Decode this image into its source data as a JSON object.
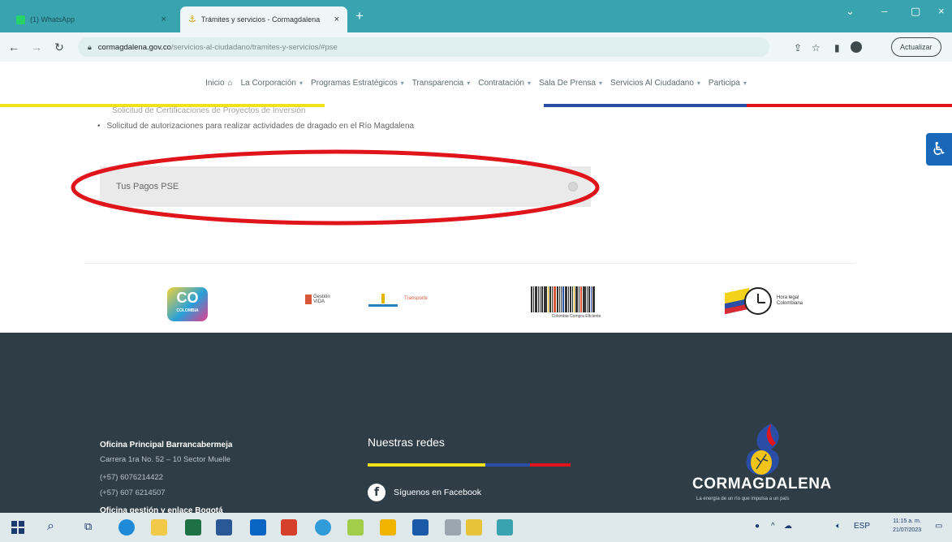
{
  "browser": {
    "tabs": [
      {
        "title": "(1) WhatsApp",
        "close": "×"
      },
      {
        "title": "Trámites y servicios - Cormagdalena",
        "close": "×"
      }
    ],
    "new_tab": "+",
    "url_host": "cormagdalena.gov.co",
    "url_path": "/servicios-al-ciudadano/tramites-y-servicios/#pse",
    "update_label": "Actualizar",
    "window_controls": [
      "⌄",
      "–",
      "▢",
      "×"
    ]
  },
  "site_nav": {
    "items": [
      {
        "label": "Inicio",
        "caret": ""
      },
      {
        "label": "La Corporación",
        "caret": "▾"
      },
      {
        "label": "Programas Estratégicos",
        "caret": "▾"
      },
      {
        "label": "Transparencia",
        "caret": "▾"
      },
      {
        "label": "Contratación",
        "caret": "▾"
      },
      {
        "label": "Sala De Prensa",
        "caret": "▾"
      },
      {
        "label": "Servicios Al Ciudadano",
        "caret": "▾"
      },
      {
        "label": "Participa",
        "caret": "▾"
      }
    ]
  },
  "content": {
    "faded_text": "Solicitud de Certificaciones de Proyectos de Inversión",
    "bullet": "Solicitud de autorizaciones para realizar actividades de dragado en el Río Magdalena",
    "pse_label": "Tus Pagos PSE",
    "annotation_color": "#e0141b"
  },
  "logos": {
    "co_big": "CO",
    "co_small": "COLOMBIA",
    "vida": [
      "Gestión",
      "VIDA"
    ],
    "transporte": "Transporte",
    "cce_caption": "Colombia Compra Eficiente",
    "hora_legal": [
      "Hora legal",
      "Colombiana"
    ]
  },
  "footer": {
    "office_title": "Oficina Principal Barrancabermeja",
    "office_lines": [
      "Carrera 1ra No. 52 – 10 Sector Muelle",
      "(+57) 6076214422",
      "(+57) 607 6214507"
    ],
    "office_title2": "Oficina gestión y enlace Bogotá",
    "social_title": "Nuestras redes",
    "facebook_label": "Síguenos en Facebook",
    "brand_name": "CORMAGDALENA",
    "brand_tagline": "La energía de un río que impulsa a un país"
  },
  "taskbar": {
    "time": "11:15 a. m.",
    "date": "21/07/2023",
    "lang": "ESP"
  },
  "colors": {
    "tab_bar": "#3aa3b0",
    "footer_bg": "#2f3e46",
    "accessibility": "#1967b8"
  }
}
